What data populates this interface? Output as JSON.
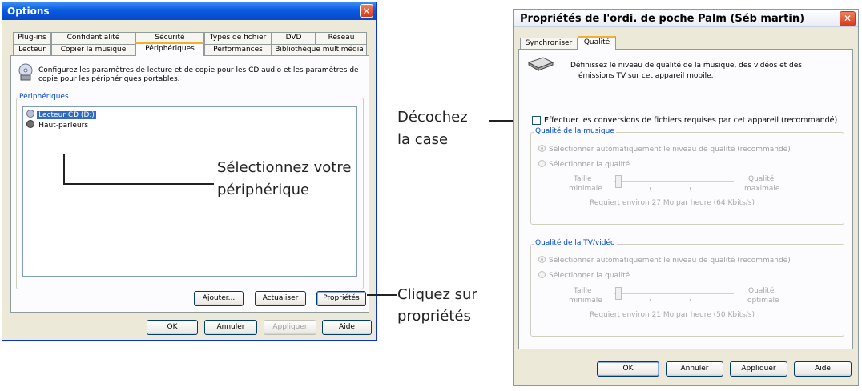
{
  "options_window": {
    "title": "Options",
    "tabs_row1": [
      "Plug-ins",
      "Confidentialité",
      "Sécurité",
      "Types de fichier",
      "DVD",
      "Réseau"
    ],
    "tabs_row2": [
      "Lecteur",
      "Copier la musique",
      "Périphériques",
      "Performances",
      "Bibliothèque multimédia"
    ],
    "selected_tab": "Périphériques",
    "description": "Configurez les paramètres de lecture et de copie pour les CD audio et les paramètres de copie pour les périphériques portables.",
    "devices_label": "Périphériques",
    "devices": [
      "Lecteur CD (D:)",
      "Haut-parleurs"
    ],
    "buttons": {
      "add": "Ajouter...",
      "refresh": "Actualiser",
      "properties": "Propriétés",
      "ok": "OK",
      "cancel": "Annuler",
      "apply": "Appliquer",
      "help": "Aide"
    }
  },
  "props_window": {
    "title": "Propriétés de l'ordi. de poche Palm (Séb martin)",
    "tabs": [
      "Synchroniser",
      "Qualité"
    ],
    "selected_tab": "Qualité",
    "description_line1": "Définissez le niveau de qualité de la musique, des vidéos et des",
    "description_line2": "émissions TV sur cet appareil mobile.",
    "checkbox_label": "Effectuer les conversions de fichiers requises par cet appareil (recommandé)",
    "checkbox_checked": false,
    "music_group": {
      "label": "Qualité de la musique",
      "radio_auto": "Sélectionner automatiquement le niveau de qualité (recommandé)",
      "radio_manual": "Sélectionner la qualité",
      "slider_min_line1": "Taille",
      "slider_min_line2": "minimale",
      "slider_max_line1": "Qualité",
      "slider_max_line2": "maximale",
      "requirement": "Requiert environ 27 Mo par heure (64 Kbits/s)"
    },
    "video_group": {
      "label": "Qualité de la TV/vidéo",
      "radio_auto": "Sélectionner automatiquement le niveau de qualité (recommandé)",
      "radio_manual": "Sélectionner la qualité",
      "slider_min_line1": "Taille",
      "slider_min_line2": "minimale",
      "slider_max_line1": "Qualité",
      "slider_max_line2": "optimale",
      "requirement": "Requiert environ 21 Mo par heure (50 Kbits/s)"
    },
    "buttons": {
      "ok": "OK",
      "cancel": "Annuler",
      "apply": "Appliquer",
      "help": "Aide"
    }
  },
  "annotations": {
    "select_device_line1": "Sélectionnez votre",
    "select_device_line2": "périphérique",
    "click_props_line1": "Cliquez sur",
    "click_props_line2": "propriétés",
    "uncheck_line1": "Décochez",
    "uncheck_line2": "la case"
  },
  "colors": {
    "xp_blue_title": "#0a5ae0",
    "dialog_face": "#ece9d8",
    "group_label_blue": "#0046d5",
    "close_red": "#d63a1a"
  }
}
